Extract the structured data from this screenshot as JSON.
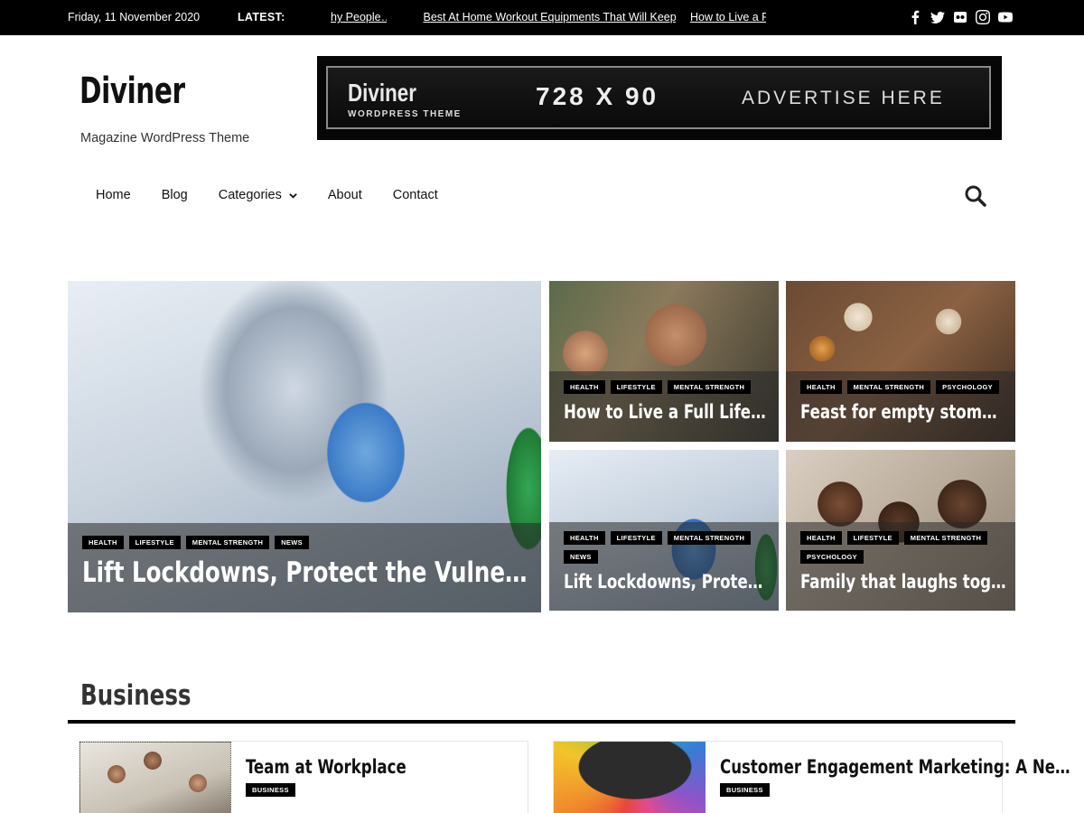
{
  "topbar": {
    "date": "Friday, 11 November 2020",
    "latest_label": "LATEST:",
    "ticker": [
      "hy People…",
      "Best At Home Workout Equipments That Will Keep…",
      "How to Live a Fu"
    ],
    "social": [
      "facebook-icon",
      "twitter-icon",
      "flickr-icon",
      "instagram-icon",
      "youtube-icon"
    ]
  },
  "header": {
    "site_title": "Diviner",
    "tagline": "Magazine WordPress Theme"
  },
  "ad": {
    "brand": "Diviner",
    "sub": "WORDPRESS THEME",
    "size": "728 X 90",
    "cta": "ADVERTISE HERE"
  },
  "nav": {
    "items": [
      "Home",
      "Blog",
      "Categories",
      "About",
      "Contact"
    ]
  },
  "featured": {
    "main": {
      "tags": [
        "HEALTH",
        "LIFESTYLE",
        "MENTAL STRENGTH",
        "NEWS"
      ],
      "title": "Lift Lockdowns, Protect the Vulnerable, Tre…"
    },
    "s1": {
      "tags": [
        "HEALTH",
        "LIFESTYLE",
        "MENTAL STRENGTH"
      ],
      "title": "How to Live a Full Life With N"
    },
    "s2": {
      "tags": [
        "HEALTH",
        "MENTAL STRENGTH",
        "PSYCHOLOGY"
      ],
      "title": "Feast for empty stomachs"
    },
    "s3": {
      "tags": [
        "HEALTH",
        "LIFESTYLE",
        "MENTAL STRENGTH",
        "NEWS"
      ],
      "title": "Lift Lockdowns, Protect the"
    },
    "s4": {
      "tags": [
        "HEALTH",
        "LIFESTYLE",
        "MENTAL STRENGTH",
        "PSYCHOLOGY"
      ],
      "title": "Family that laughs together,"
    }
  },
  "business": {
    "title": "Business",
    "posts": [
      {
        "title": "Team at Workplace",
        "tag": "BUSINESS"
      },
      {
        "title": "Customer Engagement Marketing: A Ne…",
        "tag": "BUSINESS"
      }
    ]
  }
}
